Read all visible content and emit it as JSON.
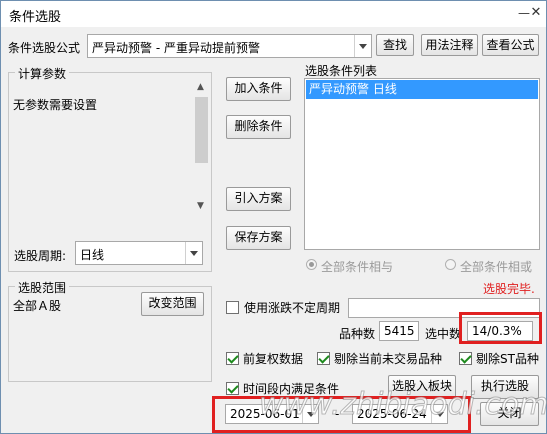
{
  "window": {
    "title": "条件选股"
  },
  "formula": {
    "label": "条件选股公式",
    "value": "严异动预警  -  严重异动提前预警",
    "find_btn": "查找",
    "usage_btn": "用法注释",
    "view_btn": "查看公式"
  },
  "params": {
    "title": "计算参数",
    "text": "无参数需要设置",
    "period_label": "选股周期:",
    "period_value": "日线"
  },
  "actions": {
    "add": "加入条件",
    "delete": "删除条件",
    "import": "引入方案",
    "save": "保存方案"
  },
  "conditions": {
    "title": "选股条件列表",
    "items": [
      "严异动预警  日线"
    ]
  },
  "logic": {
    "all_and": "全部条件相与",
    "all_or": "全部条件相或"
  },
  "status": {
    "text": "选股完毕."
  },
  "scope": {
    "title": "选股范围",
    "text": "全部Ａ股",
    "change_btn": "改变范围"
  },
  "options": {
    "variable_period": "使用涨跌不定周期",
    "count_label": "品种数",
    "count_value": "5415",
    "selected_label": "选中数",
    "selected_value": "14/0.3%",
    "prev_rights": "前复权数据",
    "exclude_untraded": "剔除当前未交易品种",
    "exclude_st": "剔除ST品种",
    "time_range": "时间段内满足条件"
  },
  "dates": {
    "start": "2025-06-01",
    "separator": "-",
    "end": "2025-06-24"
  },
  "buttons": {
    "to_block": "选股入板块",
    "execute": "执行选股",
    "close": "关闭"
  },
  "watermark": "www.zhibiaodi.com",
  "colors": {
    "accent": "#3399ff",
    "status_red": "#e02020",
    "highlight_box": "#e02020"
  }
}
